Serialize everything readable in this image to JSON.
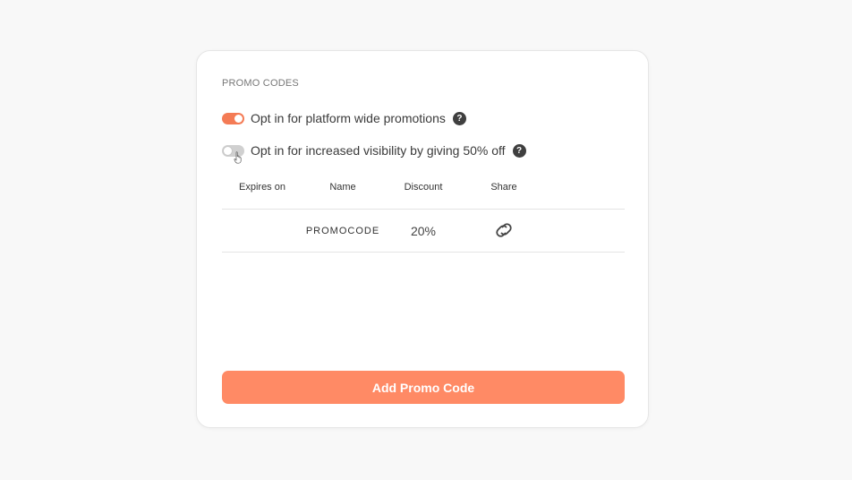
{
  "promo_codes": {
    "section_title": "PROMO CODES",
    "options": [
      {
        "label": "Opt in for platform wide promotions",
        "enabled": true,
        "help_icon": "?"
      },
      {
        "label": "Opt in for increased visibility by giving 50% off",
        "enabled": false,
        "help_icon": "?"
      }
    ],
    "table": {
      "headers": [
        "Expires on",
        "Name",
        "Discount",
        "Share"
      ],
      "rows": [
        {
          "expires_on": "",
          "name": "PROMOCODE",
          "discount": "20%",
          "share_icon": "link-icon"
        }
      ]
    },
    "add_button_label": "Add Promo Code"
  },
  "colors": {
    "accent": "#ff8a65",
    "toggle_on": "#f47b55",
    "toggle_off": "#d0d0d0",
    "background": "#f8f8f8",
    "card": "#ffffff"
  },
  "icons": {
    "help": "question-circle-icon",
    "share": "link-icon",
    "pointer": "hand-pointer-icon"
  }
}
